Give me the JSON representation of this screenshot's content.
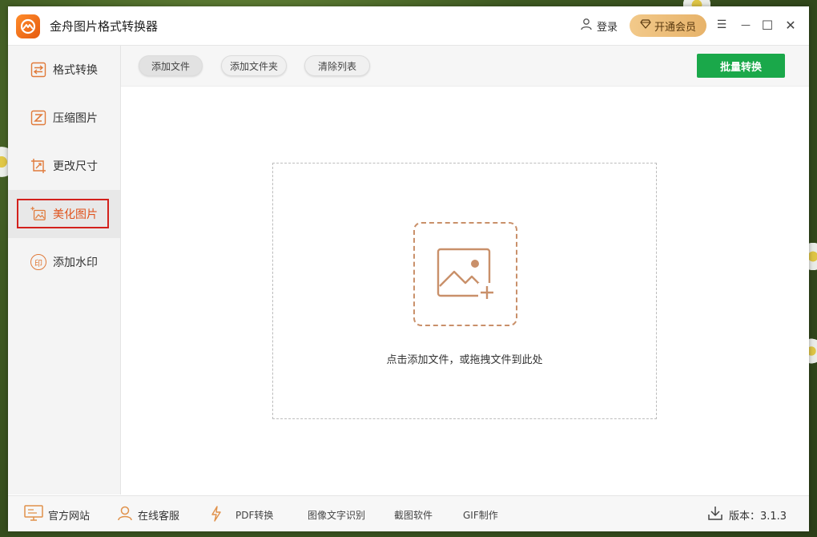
{
  "app": {
    "title": "金舟图片格式转换器",
    "login_label": "登录",
    "vip_label": "开通会员"
  },
  "window_controls": {
    "menu": "☰",
    "minimize": "—",
    "maximize": "☐",
    "close": "✕"
  },
  "sidebar": {
    "active_index": 3,
    "items": [
      {
        "label": "格式转换",
        "icon": "swap-arrows-icon"
      },
      {
        "label": "压缩图片",
        "icon": "compress-icon"
      },
      {
        "label": "更改尺寸",
        "icon": "resize-icon"
      },
      {
        "label": "美化图片",
        "icon": "magic-image-icon"
      },
      {
        "label": "添加水印",
        "icon": "watermark-seal-icon"
      }
    ],
    "watermark_icon_char": "印"
  },
  "toolbar": {
    "add_file": "添加文件",
    "add_folder": "添加文件夹",
    "clear_list": "清除列表",
    "batch_convert": "批量转换"
  },
  "dropzone": {
    "text": "点击添加文件，或拖拽文件到此处",
    "icon": "add-image-icon"
  },
  "footer": {
    "website": "官方网站",
    "support": "在线客服",
    "pdf": "PDF转换",
    "ocr": "图像文字识别",
    "screenshot": "截图软件",
    "gif": "GIF制作",
    "version": "版本：3.1.3"
  },
  "colors": {
    "accent": "#e0521c",
    "batch_green": "#1aa84a",
    "active_frame": "#d3211c",
    "vip_gold": "#e7b36a"
  }
}
